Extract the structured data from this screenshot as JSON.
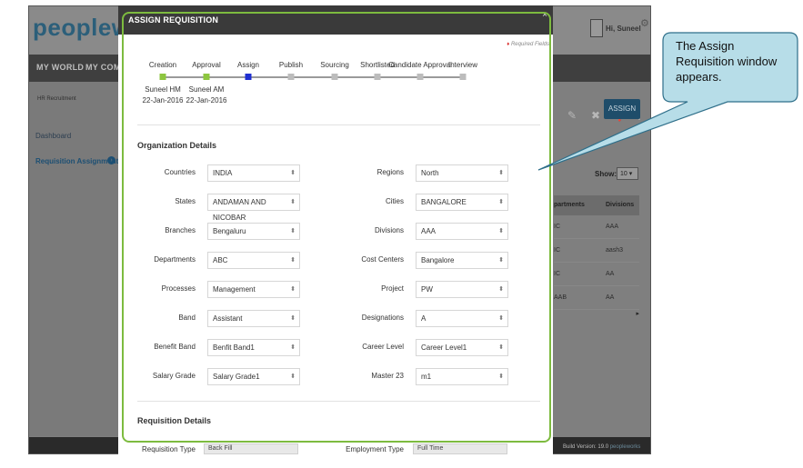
{
  "app": {
    "logo_text": "peoplew",
    "nav": [
      "MY WORLD",
      "MY COMPA"
    ],
    "user_greeting": "Hi, Suneel",
    "sidebar": {
      "module": "HR Recruitment",
      "dashboard": "Dashboard",
      "requisition_assignments": "Requisition Assignments"
    },
    "assign_button": "ASSIGN",
    "show_label": "Show:",
    "show_value": "10",
    "table": {
      "headers": [
        "partments",
        "Divisions"
      ],
      "rows": [
        [
          "IC",
          "AAA"
        ],
        [
          "IC",
          "aash3"
        ],
        [
          "IC",
          "AA"
        ],
        [
          "AAB",
          "AA"
        ]
      ]
    },
    "build_version": "Build Version: 19.0",
    "footer_brand": "peopleworks"
  },
  "modal": {
    "title": "ASSIGN REQUISITION",
    "close": "×",
    "required_note": "Required Fields",
    "steps": [
      {
        "label": "Creation",
        "status": "done",
        "name": "Suneel HM",
        "date": "22-Jan-2016"
      },
      {
        "label": "Approval",
        "status": "done",
        "name": "Suneel AM",
        "date": "22-Jan-2016"
      },
      {
        "label": "Assign",
        "status": "current"
      },
      {
        "label": "Publish",
        "status": "pending"
      },
      {
        "label": "Sourcing",
        "status": "pending"
      },
      {
        "label": "Shortlisted",
        "status": "pending"
      },
      {
        "label": "Candidate Approval",
        "status": "pending"
      },
      {
        "label": "Interview",
        "status": "pending"
      }
    ],
    "org_section_title": "Organization Details",
    "org_fields": [
      {
        "label": "Countries",
        "value": "INDIA"
      },
      {
        "label": "Regions",
        "value": "North"
      },
      {
        "label": "States",
        "value": "ANDAMAN AND NICOBAR"
      },
      {
        "label": "Cities",
        "value": "BANGALORE"
      },
      {
        "label": "Branches",
        "value": "Bengaluru"
      },
      {
        "label": "Divisions",
        "value": "AAA"
      },
      {
        "label": "Departments",
        "value": "ABC"
      },
      {
        "label": "Cost Centers",
        "value": "Bangalore"
      },
      {
        "label": "Processes",
        "value": "Management"
      },
      {
        "label": "Project",
        "value": "PW"
      },
      {
        "label": "Band",
        "value": "Assistant"
      },
      {
        "label": "Designations",
        "value": "A"
      },
      {
        "label": "Benefit Band",
        "value": "Benfit Band1"
      },
      {
        "label": "Career Level",
        "value": "Career Level1"
      },
      {
        "label": "Salary Grade",
        "value": "Salary Grade1"
      },
      {
        "label": "Master 23",
        "value": "m1"
      }
    ],
    "req_section_title": "Requisition Details",
    "req_fields": [
      {
        "label": "Requisition Type",
        "value": "Back Fill"
      },
      {
        "label": "Employment Type",
        "value": "Full Time"
      }
    ]
  },
  "callout": {
    "text": "The Assign Requisition window appears."
  },
  "colors": {
    "highlight_green": "#7dbb3f",
    "callout_fill": "#b7dde8",
    "step_done": "#8dc63f",
    "step_current": "#1f2fd1"
  }
}
